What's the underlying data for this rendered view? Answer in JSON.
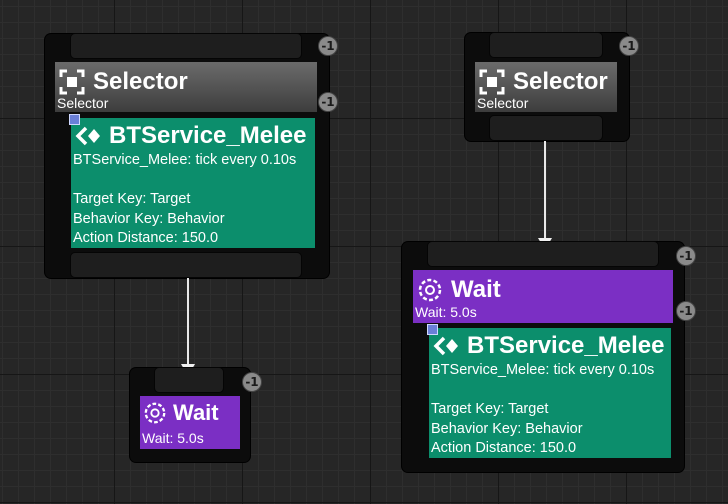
{
  "nodes": {
    "selector_left": {
      "title": "Selector",
      "subtitle": "Selector",
      "badge_top": "-1",
      "badge_mid": "-1"
    },
    "service_left": {
      "title": "BTService_Melee",
      "desc": "BTService_Melee: tick every 0.10s",
      "target_key": "Target Key: Target",
      "behavior_key": "Behavior Key: Behavior",
      "action_distance": "Action Distance: 150.0"
    },
    "wait_left": {
      "title": "Wait",
      "subtitle": "Wait: 5.0s",
      "badge": "-1"
    },
    "selector_right": {
      "title": "Selector",
      "subtitle": "Selector",
      "badge": "-1"
    },
    "wait_right": {
      "title": "Wait",
      "subtitle": "Wait: 5.0s",
      "badge_top": "-1",
      "badge_mid": "-1"
    },
    "service_right": {
      "title": "BTService_Melee",
      "desc": "BTService_Melee: tick every 0.10s",
      "target_key": "Target Key: Target",
      "behavior_key": "Behavior Key: Behavior",
      "action_distance": "Action Distance: 150.0"
    }
  },
  "icons": {
    "selector": "selector-icon",
    "wait": "wait-clock-icon",
    "service": "service-icon"
  },
  "colors": {
    "selector": "#4e4e4e",
    "wait": "#7b2fc4",
    "service": "#0c8e6c",
    "wire": "#e8e8e8"
  }
}
